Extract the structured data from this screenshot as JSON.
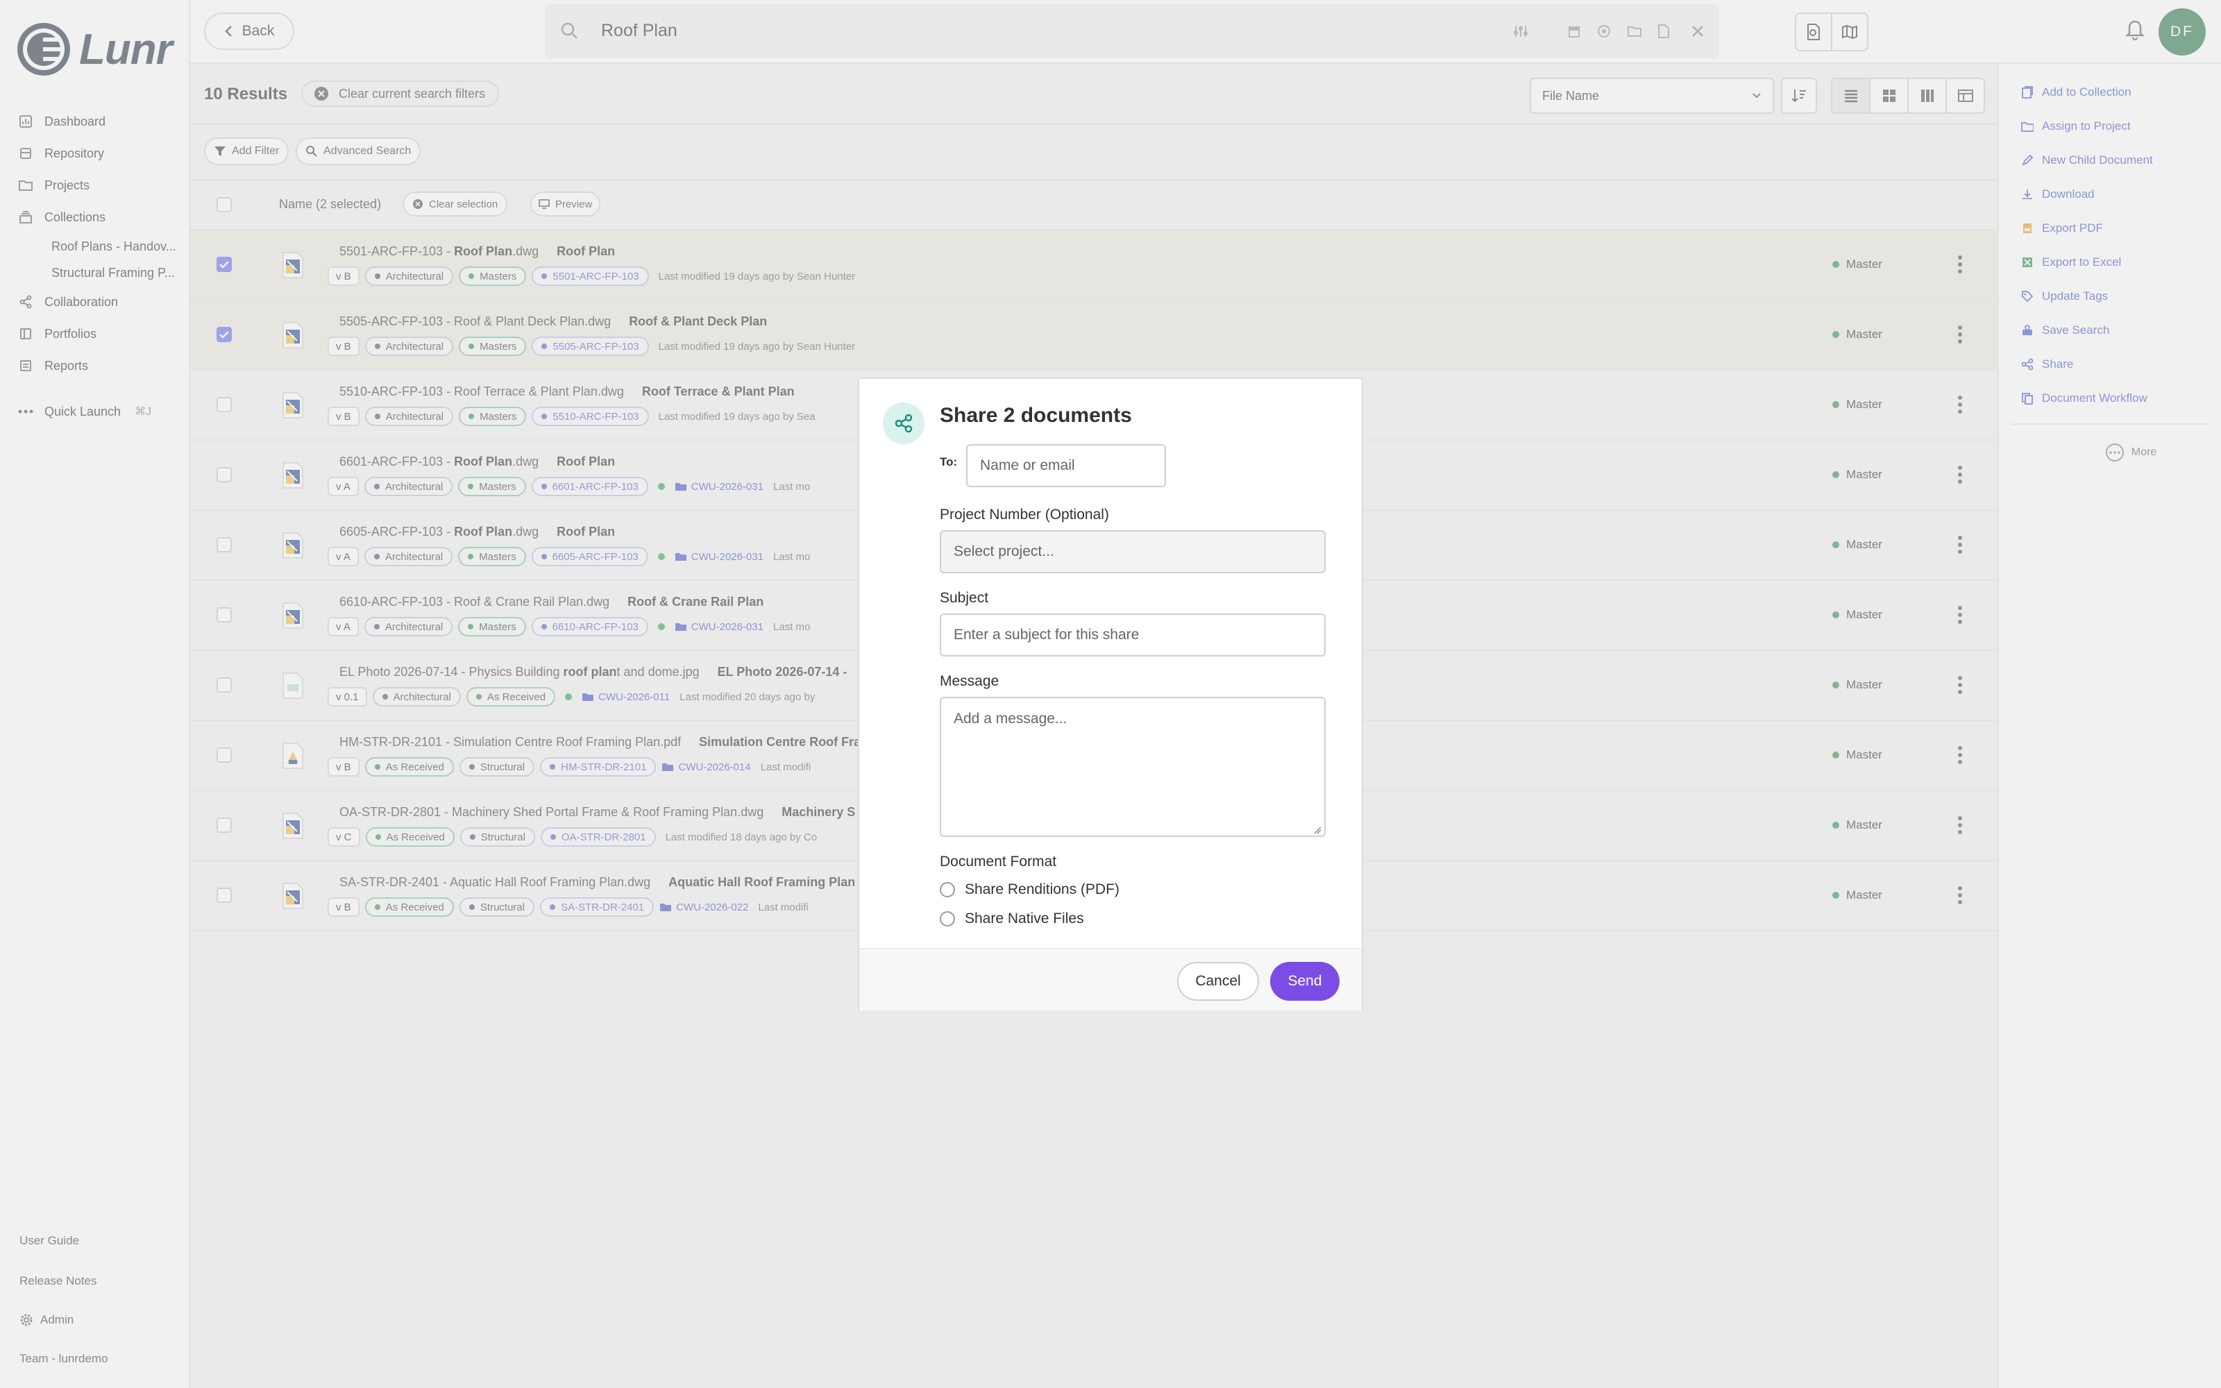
{
  "app": {
    "logo_text": "Lunr"
  },
  "sidebar": {
    "nav": [
      {
        "label": "Dashboard",
        "icon": "dashboard-icon"
      },
      {
        "label": "Repository",
        "icon": "repository-icon"
      },
      {
        "label": "Projects",
        "icon": "folder-icon"
      },
      {
        "label": "Collections",
        "icon": "collections-icon"
      }
    ],
    "collections": [
      "Roof Plans - Handov...",
      "Structural Framing P..."
    ],
    "nav2": [
      {
        "label": "Collaboration",
        "icon": "share-icon"
      },
      {
        "label": "Portfolios",
        "icon": "portfolio-icon"
      },
      {
        "label": "Reports",
        "icon": "reports-icon"
      }
    ],
    "quick_launch": {
      "label": "Quick Launch",
      "shortcut": "⌘J"
    },
    "footer": {
      "user_guide": "User Guide",
      "release_notes": "Release Notes",
      "admin": "Admin",
      "team": "Team - lunrdemo"
    }
  },
  "topbar": {
    "back_label": "Back",
    "search_value": "Roof Plan",
    "avatar_initials": "DF"
  },
  "results": {
    "count_label": "10 Results",
    "clear_filters": "Clear current search filters",
    "sort_field": "File Name",
    "add_filter": "Add Filter",
    "advanced_search": "Advanced Search",
    "header": {
      "name": "Name (2 selected)",
      "clear_selection": "Clear selection",
      "preview": "Preview"
    },
    "rows": [
      {
        "selected": true,
        "file_prefix": "5501-ARC-FP-103 - ",
        "file_bold": "Roof Plan",
        "file_suffix": ".dwg",
        "title": "Roof Plan",
        "version": "v B",
        "pills": [
          [
            "Architectural",
            "gray"
          ],
          [
            "Masters",
            "green"
          ],
          [
            "5501-ARC-FP-103",
            "blue"
          ]
        ],
        "pin": false,
        "folder": "",
        "modified": "Last modified 19 days ago by Sean Hunter",
        "status": "Master"
      },
      {
        "selected": true,
        "file_prefix": "5505-ARC-FP-103 - Roof & Plant Deck Plan.dwg",
        "file_bold": "",
        "file_suffix": "",
        "title": "Roof & Plant Deck Plan",
        "version": "v B",
        "pills": [
          [
            "Architectural",
            "gray"
          ],
          [
            "Masters",
            "green"
          ],
          [
            "5505-ARC-FP-103",
            "blue"
          ]
        ],
        "pin": false,
        "folder": "",
        "modified": "Last modified 19 days ago by Sean Hunter",
        "status": "Master"
      },
      {
        "selected": false,
        "file_prefix": "5510-ARC-FP-103 - Roof Terrace & Plant Plan.dwg",
        "file_bold": "",
        "file_suffix": "",
        "title": "Roof Terrace & Plant Plan",
        "version": "v B",
        "pills": [
          [
            "Architectural",
            "gray"
          ],
          [
            "Masters",
            "green"
          ],
          [
            "5510-ARC-FP-103",
            "blue"
          ]
        ],
        "pin": false,
        "folder": "",
        "modified": "Last modified 19 days ago by Sea",
        "status": "Master"
      },
      {
        "selected": false,
        "file_prefix": "6601-ARC-FP-103 - ",
        "file_bold": "Roof Plan",
        "file_suffix": ".dwg",
        "title": "Roof Plan",
        "version": "v A",
        "pills": [
          [
            "Architectural",
            "gray"
          ],
          [
            "Masters",
            "green"
          ],
          [
            "6601-ARC-FP-103",
            "blue"
          ]
        ],
        "pin": true,
        "folder": "CWU-2026-031",
        "modified": "Last mo",
        "status": "Master"
      },
      {
        "selected": false,
        "file_prefix": "6605-ARC-FP-103 - ",
        "file_bold": "Roof Plan",
        "file_suffix": ".dwg",
        "title": "Roof Plan",
        "version": "v A",
        "pills": [
          [
            "Architectural",
            "gray"
          ],
          [
            "Masters",
            "green"
          ],
          [
            "6605-ARC-FP-103",
            "blue"
          ]
        ],
        "pin": true,
        "folder": "CWU-2026-031",
        "modified": "Last mo",
        "status": "Master"
      },
      {
        "selected": false,
        "file_prefix": "6610-ARC-FP-103 - Roof & Crane Rail Plan.dwg",
        "file_bold": "",
        "file_suffix": "",
        "title": "Roof & Crane Rail Plan",
        "version": "v A",
        "pills": [
          [
            "Architectural",
            "gray"
          ],
          [
            "Masters",
            "green"
          ],
          [
            "6610-ARC-FP-103",
            "blue"
          ]
        ],
        "pin": true,
        "folder": "CWU-2026-031",
        "modified": "Last mo",
        "status": "Master"
      },
      {
        "selected": false,
        "file_prefix": "EL Photo 2026-07-14 - Physics Building ",
        "file_bold": "roof plan",
        "file_suffix": "t and dome.jpg",
        "title": "EL Photo 2026-07-14 -",
        "version": "v 0.1",
        "pills": [
          [
            "Architectural",
            "gray"
          ],
          [
            "As Received",
            "green"
          ]
        ],
        "pin": true,
        "folder": "CWU-2026-011",
        "modified": "Last modified 20 days ago by",
        "status": "Master"
      },
      {
        "selected": false,
        "file_prefix": "HM-STR-DR-2101 - Simulation Centre Roof Framing Plan.pdf",
        "file_bold": "",
        "file_suffix": "",
        "title": "Simulation Centre Roof Fra",
        "version": "v B",
        "pills": [
          [
            "As Received",
            "green"
          ],
          [
            "Structural",
            "gray"
          ],
          [
            "HM-STR-DR-2101",
            "blue"
          ]
        ],
        "pin": false,
        "folder": "CWU-2026-014",
        "modified": "Last modifi",
        "status": "Master"
      },
      {
        "selected": false,
        "file_prefix": "OA-STR-DR-2801 - Machinery Shed Portal Frame & Roof Framing Plan.dwg",
        "file_bold": "",
        "file_suffix": "",
        "title": "Machinery S",
        "version": "v C",
        "pills": [
          [
            "As Received",
            "green"
          ],
          [
            "Structural",
            "gray"
          ],
          [
            "OA-STR-DR-2801",
            "blue"
          ]
        ],
        "pin": false,
        "folder": "",
        "modified": "Last modified 18 days ago by Co",
        "status": "Master"
      },
      {
        "selected": false,
        "file_prefix": "SA-STR-DR-2401 - Aquatic Hall Roof Framing Plan.dwg",
        "file_bold": "",
        "file_suffix": "",
        "title": "Aquatic Hall Roof Framing Plan",
        "version": "v B",
        "pills": [
          [
            "As Received",
            "green"
          ],
          [
            "Structural",
            "gray"
          ],
          [
            "SA-STR-DR-2401",
            "blue"
          ]
        ],
        "pin": false,
        "folder": "CWU-2026-022",
        "modified": "Last modifi",
        "status": "Master"
      }
    ]
  },
  "actions": {
    "items": [
      "Add to Collection",
      "Assign to Project",
      "New Child Document",
      "Download",
      "Export PDF",
      "Export to Excel",
      "Update Tags",
      "Save Search",
      "Share",
      "Document Workflow"
    ],
    "more": "More"
  },
  "modal": {
    "title": "Share 2 documents",
    "to_label": "To:",
    "to_placeholder": "Name or email",
    "project_label": "Project Number (Optional)",
    "project_placeholder": "Select project...",
    "subject_label": "Subject",
    "subject_placeholder": "Enter a subject for this share",
    "message_label": "Message",
    "message_placeholder": "Add a message...",
    "format_label": "Document Format",
    "format_options": [
      "Share Renditions (PDF)",
      "Share Native Files"
    ],
    "cancel": "Cancel",
    "send": "Send"
  },
  "colors": {
    "accent": "#7b4de6",
    "link": "#4a56c8",
    "status_green": "#2f9456",
    "selected_row": "#ebe9e1"
  }
}
